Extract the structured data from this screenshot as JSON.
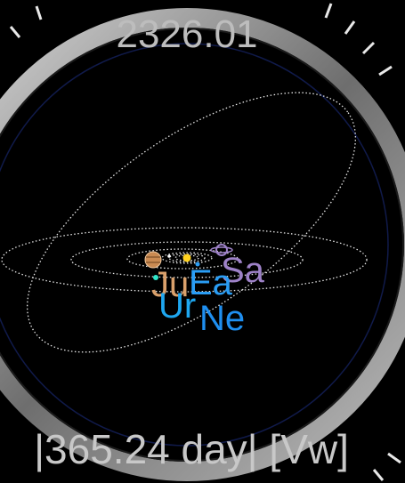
{
  "watch": {
    "date_readout": "2326.01",
    "period_readout": "|365.24 day| [Vw]"
  },
  "planet_labels": {
    "earth": "Ea",
    "saturn": "Sa",
    "jupiter": "Ju",
    "uranus": "Ur",
    "neptune": "Ne"
  },
  "colors": {
    "background": "#000000",
    "readout_text": "#bdbdbd",
    "orbit": "#e6e6e6",
    "sun": "#ffd21f",
    "jupiter": "#d9a06b",
    "saturn": "#9e82c8",
    "earth": "#2a9df4",
    "uranus": "#1ea7f0",
    "neptune": "#1f8ff0",
    "mercury": "#2ee6c8"
  }
}
